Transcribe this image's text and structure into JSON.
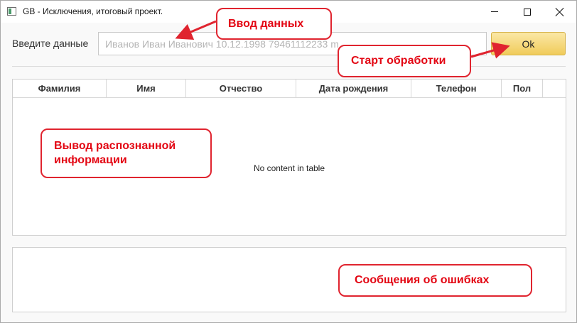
{
  "window": {
    "title": "GB - Исключения, итоговый проект."
  },
  "input": {
    "label": "Введите данные",
    "placeholder": "Иванов Иван Иванович 10.12.1998 79461112233 m",
    "button_label": "Ok"
  },
  "table": {
    "columns": [
      "Фамилия",
      "Имя",
      "Отчество",
      "Дата рождения",
      "Телефон",
      "Пол"
    ],
    "empty_message": "No content in table"
  },
  "annotations": {
    "input": "Ввод данных",
    "start": "Старт обработки",
    "output_line1": "Вывод распознанной",
    "output_line2": "информации",
    "errors": "Сообщения об ошибках"
  },
  "colors": {
    "annotation": "#e30613",
    "button": "#f0cb5a"
  }
}
